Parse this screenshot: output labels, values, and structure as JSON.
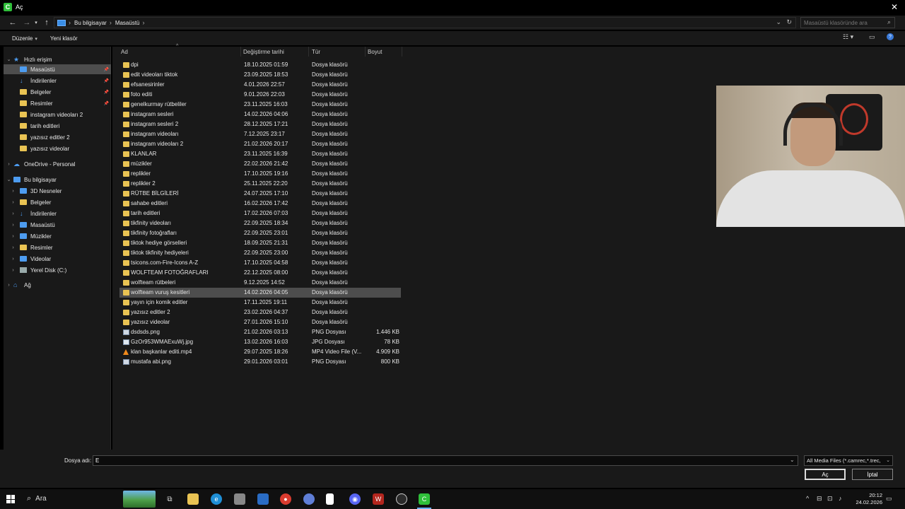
{
  "window": {
    "title": "Aç",
    "app_icon_letter": "C",
    "close_glyph": "✕"
  },
  "address": {
    "crumbs": [
      "Bu bilgisayar",
      "Masaüstü"
    ],
    "search_placeholder": "Masaüstü klasöründe ara"
  },
  "toolbar": {
    "organize_label": "Düzenle",
    "new_folder_label": "Yeni klasör"
  },
  "nav": {
    "quick_access": "Hızlı erişim",
    "quick_items": [
      {
        "label": "Masaüstü",
        "icon": "blue",
        "pinned": true,
        "selected": true
      },
      {
        "label": "İndirilenler",
        "icon": "down",
        "pinned": true
      },
      {
        "label": "Belgeler",
        "icon": "folder",
        "pinned": true
      },
      {
        "label": "Resimler",
        "icon": "folder",
        "pinned": true
      },
      {
        "label": "instagram videoları 2",
        "icon": "folder"
      },
      {
        "label": "tarih editleri",
        "icon": "folder"
      },
      {
        "label": "yazısız editler 2",
        "icon": "folder"
      },
      {
        "label": "yazısız videolar",
        "icon": "folder"
      }
    ],
    "onedrive": "OneDrive - Personal",
    "this_pc": "Bu bilgisayar",
    "pc_items": [
      {
        "label": "3D Nesneler",
        "icon": "blue"
      },
      {
        "label": "Belgeler",
        "icon": "folder"
      },
      {
        "label": "İndirilenler",
        "icon": "down"
      },
      {
        "label": "Masaüstü",
        "icon": "blue"
      },
      {
        "label": "Müzikler",
        "icon": "blue"
      },
      {
        "label": "Resimler",
        "icon": "folder"
      },
      {
        "label": "Videolar",
        "icon": "blue"
      },
      {
        "label": "Yerel Disk (C:)",
        "icon": "disk"
      }
    ],
    "network": "Ağ"
  },
  "columns": {
    "name": "Ad",
    "date": "Değiştirme tarihi",
    "type": "Tür",
    "size": "Boyut"
  },
  "files": [
    {
      "name": "dpi",
      "date": "18.10.2025 01:59",
      "type": "Dosya klasörü",
      "size": "",
      "icon": "folder"
    },
    {
      "name": "edit videoları tiktok",
      "date": "23.09.2025 18:53",
      "type": "Dosya klasörü",
      "size": "",
      "icon": "folder"
    },
    {
      "name": "efsanesirinler",
      "date": "4.01.2026 22:57",
      "type": "Dosya klasörü",
      "size": "",
      "icon": "folder"
    },
    {
      "name": "foto editi",
      "date": "9.01.2026 22:03",
      "type": "Dosya klasörü",
      "size": "",
      "icon": "folder"
    },
    {
      "name": "genelkurmay rütbeliler",
      "date": "23.11.2025 16:03",
      "type": "Dosya klasörü",
      "size": "",
      "icon": "folder"
    },
    {
      "name": "instagram sesleri",
      "date": "14.02.2026 04:06",
      "type": "Dosya klasörü",
      "size": "",
      "icon": "folder"
    },
    {
      "name": "instagram sesleri 2",
      "date": "28.12.2025 17:21",
      "type": "Dosya klasörü",
      "size": "",
      "icon": "folder"
    },
    {
      "name": "instagram videoları",
      "date": "7.12.2025 23:17",
      "type": "Dosya klasörü",
      "size": "",
      "icon": "folder"
    },
    {
      "name": "instagram videoları 2",
      "date": "21.02.2026 20:17",
      "type": "Dosya klasörü",
      "size": "",
      "icon": "folder"
    },
    {
      "name": "KLANLAR",
      "date": "23.11.2025 16:39",
      "type": "Dosya klasörü",
      "size": "",
      "icon": "folder"
    },
    {
      "name": "müzikler",
      "date": "22.02.2026 21:42",
      "type": "Dosya klasörü",
      "size": "",
      "icon": "folder"
    },
    {
      "name": "replikler",
      "date": "17.10.2025 19:16",
      "type": "Dosya klasörü",
      "size": "",
      "icon": "folder"
    },
    {
      "name": "replikler 2",
      "date": "25.11.2025 22:20",
      "type": "Dosya klasörü",
      "size": "",
      "icon": "folder"
    },
    {
      "name": "RÜTBE BİLGİLERİ",
      "date": "24.07.2025 17:10",
      "type": "Dosya klasörü",
      "size": "",
      "icon": "folder"
    },
    {
      "name": "sahabe editleri",
      "date": "16.02.2026 17:42",
      "type": "Dosya klasörü",
      "size": "",
      "icon": "folder"
    },
    {
      "name": "tarih editleri",
      "date": "17.02.2026 07:03",
      "type": "Dosya klasörü",
      "size": "",
      "icon": "folder"
    },
    {
      "name": "tikfinity videoları",
      "date": "22.09.2025 18:34",
      "type": "Dosya klasörü",
      "size": "",
      "icon": "folder"
    },
    {
      "name": "tikfinity fotoğrafları",
      "date": "22.09.2025 23:01",
      "type": "Dosya klasörü",
      "size": "",
      "icon": "folder"
    },
    {
      "name": "tiktok hediye görselleri",
      "date": "18.09.2025 21:31",
      "type": "Dosya klasörü",
      "size": "",
      "icon": "folder"
    },
    {
      "name": "tiktok tikfinity hediyeleri",
      "date": "22.09.2025 23:00",
      "type": "Dosya klasörü",
      "size": "",
      "icon": "folder"
    },
    {
      "name": "tsicons.com-Fire-Icons A-Z",
      "date": "17.10.2025 04:58",
      "type": "Dosya klasörü",
      "size": "",
      "icon": "folder"
    },
    {
      "name": "WOLFTEAM FOTOĞRAFLARI",
      "date": "22.12.2025 08:00",
      "type": "Dosya klasörü",
      "size": "",
      "icon": "folder"
    },
    {
      "name": "wolfteam rütbeleri",
      "date": "9.12.2025 14:52",
      "type": "Dosya klasörü",
      "size": "",
      "icon": "folder"
    },
    {
      "name": "wolfteam vuruş kesitleri",
      "date": "14.02.2026 04:05",
      "type": "Dosya klasörü",
      "size": "",
      "icon": "folder",
      "selected": true
    },
    {
      "name": "yayın için komik editler",
      "date": "17.11.2025 19:11",
      "type": "Dosya klasörü",
      "size": "",
      "icon": "folder"
    },
    {
      "name": "yazısız editler 2",
      "date": "23.02.2026 04:37",
      "type": "Dosya klasörü",
      "size": "",
      "icon": "folder"
    },
    {
      "name": "yazısız videolar",
      "date": "27.01.2026 15:10",
      "type": "Dosya klasörü",
      "size": "",
      "icon": "folder"
    },
    {
      "name": "dsdsds.png",
      "date": "21.02.2026 03:13",
      "type": "PNG Dosyası",
      "size": "1.446 KB",
      "icon": "png"
    },
    {
      "name": "GzOr953WMAExuWj.jpg",
      "date": "13.02.2026 16:03",
      "type": "JPG Dosyası",
      "size": "78 KB",
      "icon": "jpg"
    },
    {
      "name": "klan başkanlar editi.mp4",
      "date": "29.07.2025 18:26",
      "type": "MP4 Video File (V...",
      "size": "4.909 KB",
      "icon": "mp4"
    },
    {
      "name": "mustafa abi.png",
      "date": "29.01.2026 03:01",
      "type": "PNG Dosyası",
      "size": "800 KB",
      "icon": "png"
    }
  ],
  "bottom": {
    "filename_label": "Dosya adı:",
    "filename_value": "E",
    "filter_value": "All Media Files (*.camrec,*.trec,",
    "open_label": "Aç",
    "cancel_label": "İptal"
  },
  "taskbar": {
    "search_label": "Ara",
    "clock_time": "20:12",
    "clock_date": "24.02.2026"
  },
  "colors": {
    "background": "#191919",
    "selection": "#4d4d4d",
    "folder": "#e9c353",
    "accent_blue": "#4d9cf0"
  }
}
